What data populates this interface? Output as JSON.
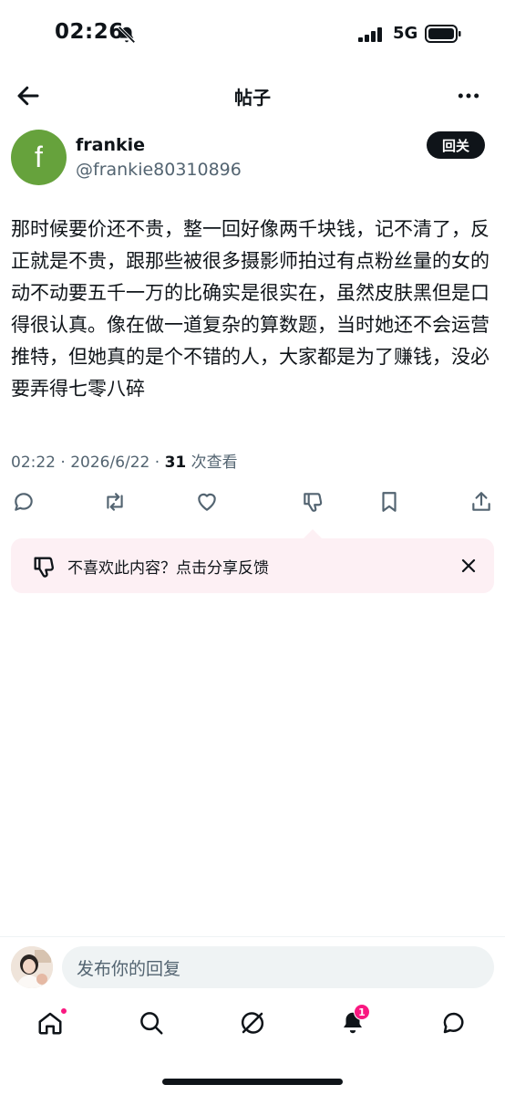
{
  "status_bar": {
    "time": "02:26",
    "network": "5G"
  },
  "header": {
    "title": "帖子"
  },
  "author": {
    "avatar_letter": "f",
    "avatar_color": "#66a23c",
    "name": "frankie",
    "handle": "@frankie80310896",
    "follow_label": "回关"
  },
  "post": {
    "text": "那时候要价还不贵，整一回好像两千块钱，记不清了，反正就是不贵，跟那些被很多摄影师拍过有点粉丝量的女的动不动要五千一万的比确实是很实在，虽然皮肤黑但是口得很认真。像在做一道复杂的算数题，当时她还不会运营推特，但她真的是个不错的人，大家都是为了赚钱，没必要弄得七零八碎",
    "meta_prefix": "02:22 · 2026/6/22 · ",
    "views_count": "31",
    "views_label": " 次查看"
  },
  "actions": {
    "icons": [
      "reply-icon",
      "retweet-icon",
      "like-icon",
      "dislike-icon",
      "bookmark-icon",
      "share-icon"
    ]
  },
  "feedback": {
    "text": "不喜欢此内容？点击分享反馈"
  },
  "reply": {
    "placeholder": "发布你的回复"
  },
  "tabbar": {
    "notifications_badge": "1"
  },
  "colors": {
    "accent": "#0f1419",
    "secondary_text": "#536471",
    "notification": "#f91880",
    "feedback_bg": "#fdf0f4"
  }
}
